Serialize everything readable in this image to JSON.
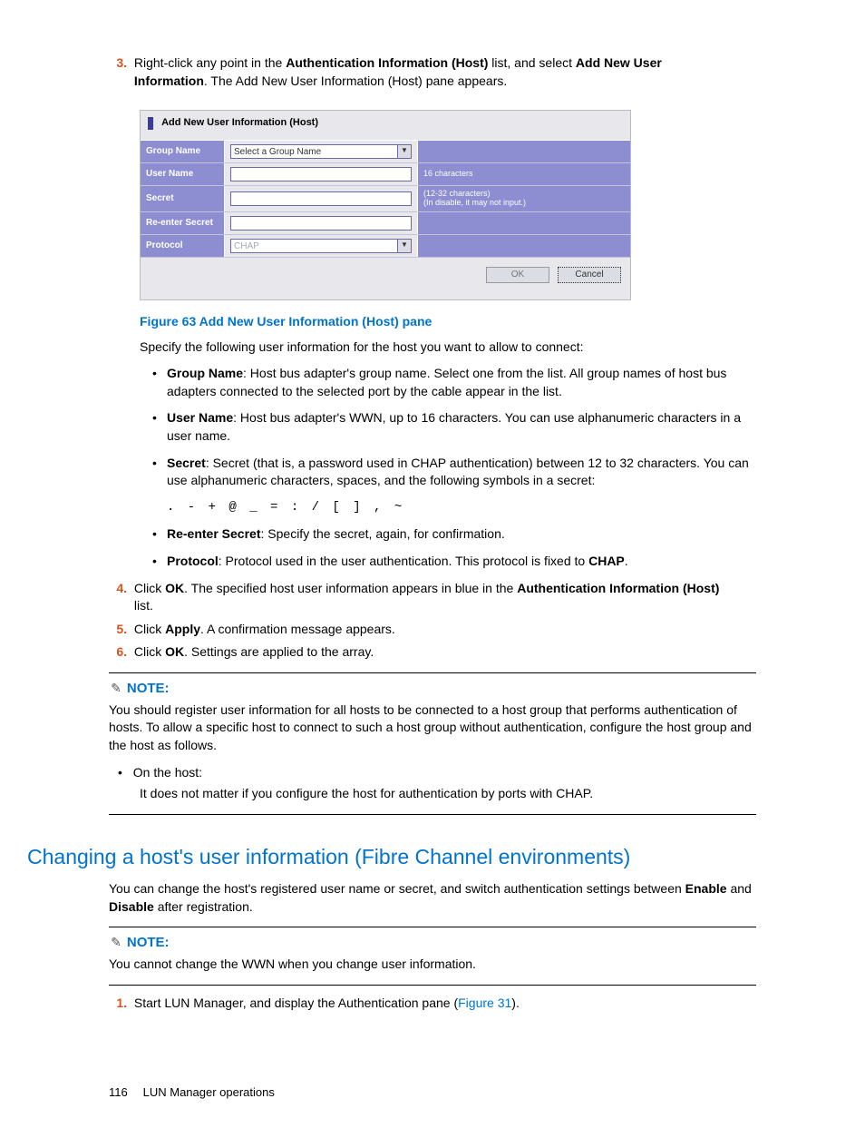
{
  "steps": {
    "s3": {
      "num": "3.",
      "pre": "Right-click any point in the ",
      "b1": "Authentication Information (Host)",
      "mid": " list, and select ",
      "b2": "Add New User Information",
      "post": ".  The Add New User Information (Host) pane appears."
    },
    "s4": {
      "num": "4.",
      "pre": "Click ",
      "b1": "OK",
      "mid1": ". The specified host user information appears in blue in the ",
      "b2": "Authentication Information (Host)",
      "post": " list."
    },
    "s5": {
      "num": "5.",
      "pre": "Click ",
      "b1": "Apply",
      "post": ".  A confirmation message appears."
    },
    "s6": {
      "num": "6.",
      "pre": "Click ",
      "b1": "OK",
      "post": ". Settings are applied to the array."
    }
  },
  "dialog": {
    "title": "Add New User Information (Host)",
    "rows": {
      "group": {
        "label": "Group Name",
        "value": "Select a Group Name"
      },
      "user": {
        "label": "User Name",
        "hint": "16 characters"
      },
      "secret": {
        "label": "Secret",
        "hint1": "(12-32 characters)",
        "hint2": "(In disable, it may not input.)"
      },
      "re": {
        "label": "Re-enter Secret"
      },
      "proto": {
        "label": "Protocol",
        "value": "CHAP"
      }
    },
    "ok": "OK",
    "cancel": "Cancel"
  },
  "figure_caption": "Figure 63 Add New User Information (Host) pane",
  "specify_text": "Specify the following user information for the host you want to allow to connect:",
  "bullets": {
    "group": {
      "b": "Group Name",
      "t": ": Host bus adapter's group name.  Select one from the list.  All group names of host bus adapters connected to the selected port by the cable appear in the list."
    },
    "user": {
      "b": "User Name",
      "t": ": Host bus adapter's WWN, up to 16 characters.  You can use alphanumeric characters in a user name."
    },
    "secret": {
      "b": "Secret",
      "t": ": Secret (that is, a password used in CHAP authentication) between 12 to 32 characters. You can use alphanumeric characters, spaces, and the following symbols in a secret:"
    },
    "re": {
      "b": "Re-enter Secret",
      "t": ": Specify the secret, again, for confirmation."
    },
    "proto_pre": "Protocol",
    "proto_mid": ": Protocol used in the user authentication.  This protocol is fixed to ",
    "proto_b2": "CHAP",
    "proto_post": "."
  },
  "symbols": ". - + @ _ = : / [ ] , ~",
  "note1": {
    "label": "NOTE:",
    "body": "You should register user information for all hosts to be connected to a host group that performs authentication of hosts. To allow a specific host to connect to such a host group without authentication, configure the host group and the host as follows.",
    "bullet": "On the host:",
    "sub": "It does not matter if you configure the host for authentication by ports with CHAP."
  },
  "section_title": "Changing a host's user information (Fibre Channel environments)",
  "section_intro_pre": "You can change the host's registered user name or secret, and switch authentication settings between ",
  "section_intro_b1": "Enable",
  "section_intro_mid": " and ",
  "section_intro_b2": "Disable",
  "section_intro_post": " after registration.",
  "note2": {
    "label": "NOTE:",
    "body": "You cannot change the WWN when you change user information."
  },
  "step_sec1": {
    "num": "1.",
    "pre": "Start LUN Manager, and display the Authentication pane (",
    "xref": "Figure 31",
    "post": ")."
  },
  "footer": {
    "page": "116",
    "title": "LUN Manager operations"
  }
}
